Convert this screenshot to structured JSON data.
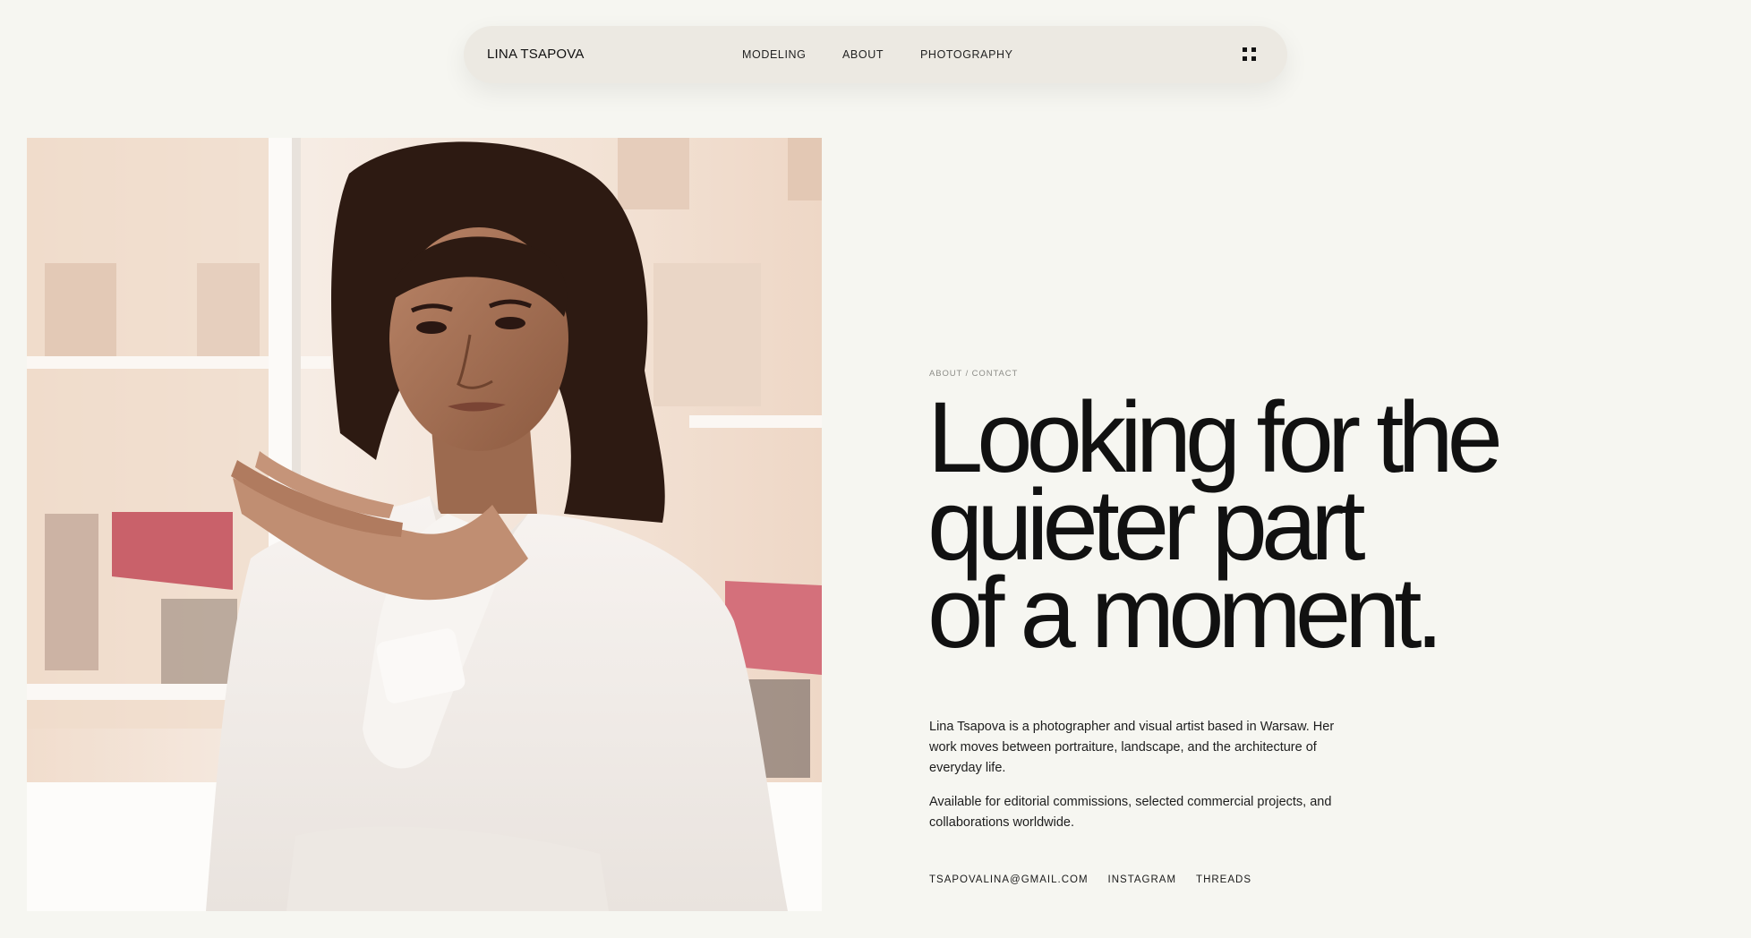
{
  "nav": {
    "brand": "LINA TSAPOVA",
    "links": [
      "MODELING",
      "ABOUT",
      "PHOTOGRAPHY"
    ],
    "menu_icon": "grid-icon"
  },
  "hero": {
    "photo_description_icon": "portrait-photo",
    "eyebrow": "ABOUT / CONTACT",
    "headline": [
      "Looking for the",
      "quieter part",
      "of a moment."
    ],
    "paragraphs": [
      "Lina Tsapova is a photographer and visual artist based in Warsaw. Her work moves between portraiture, landscape, and the architecture of everyday life.",
      "Available for editorial commissions, selected commercial projects, and collaborations worldwide."
    ],
    "contacts": [
      "TSAPOVALINA@GMAIL.COM",
      "INSTAGRAM",
      "THREADS"
    ]
  },
  "colors": {
    "background": "#f6f6f1",
    "nav_pill": "#ece9e2",
    "text": "#141414"
  }
}
